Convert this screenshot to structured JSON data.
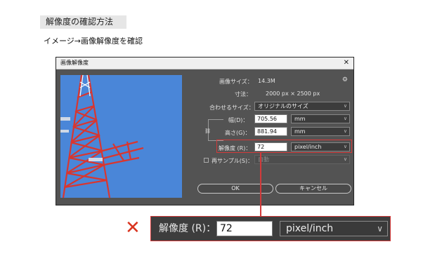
{
  "heading": "解像度の確認方法",
  "subheading": "イメージ→画像解像度を確認",
  "dialog": {
    "title": "画像解像度",
    "close_icon": "✕",
    "image_size_label": "画像サイズ：",
    "image_size_value": "14.3M",
    "gear_icon": "gear-icon",
    "dimensions_label": "寸法：",
    "dimensions_value": "2000 px × 2500 px",
    "fit_label": "合わせるサイズ：",
    "fit_value": "オリジナルのサイズ",
    "width_label": "幅(D)：",
    "width_value": "705.56",
    "width_unit": "mm",
    "height_label": "高さ(G)：",
    "height_value": "881.94",
    "height_unit": "mm",
    "resolution_label": "解像度 (R)：",
    "resolution_value": "72",
    "resolution_unit": "pixel/inch",
    "resample_label": "再サンプル(S)：",
    "resample_value": "自動",
    "ok_label": "OK",
    "cancel_label": "キャンセル"
  },
  "zoom": {
    "mark": "✕",
    "resolution_label": "解像度 (R)：",
    "resolution_value": "72",
    "resolution_unit": "pixel/inch"
  },
  "colors": {
    "highlight": "#d33a3a",
    "dialog_bg": "#535353",
    "sky": "#4784d6",
    "tower": "#d9362f"
  }
}
